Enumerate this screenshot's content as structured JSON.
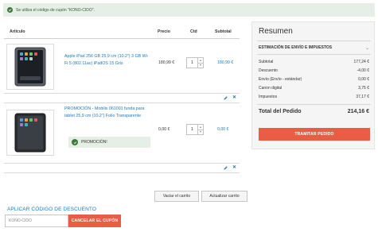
{
  "notice": {
    "text": "Se utiliza el código de cupón \"KONO-CIDO\"."
  },
  "table": {
    "headers": {
      "item": "Artículo",
      "price": "Precio",
      "qty": "Ctd",
      "subtotal": "Subtotal"
    }
  },
  "items": [
    {
      "name": "Apple iPad 256 GB 25,9 cm (10.2\") 3 GB Wi-Fi 5 (802.11ac) iPadOS 15 Gris",
      "price": "180,99 €",
      "qty": "1",
      "subtotal": "180,99 €",
      "image_icon": "tablet-icon",
      "promo": null
    },
    {
      "name": "PROMOCIÓN - Mobilis 061001 funda para tablet 25,9 cm (10.2\") Folio Transparente",
      "price": "0,00 €",
      "qty": "1",
      "subtotal": "0,00 €",
      "image_icon": "tablet-case-icon",
      "promo": "PROMOCIÓN!"
    }
  ],
  "actions": {
    "clear_cart": "Vaciar el carrito",
    "update_cart": "Actualizar carrito"
  },
  "discount": {
    "title": "APLICAR CÓDIGO DE DESCUENTO",
    "code_value": "KONO-CIDO",
    "cancel_label": "CANCELAR EL CUPÓN"
  },
  "summary": {
    "title": "Resumen",
    "shipping_label": "ESTIMACIÓN DE ENVÍO E IMPUESTOS",
    "rows": [
      {
        "label": "Subtotal",
        "value": "177,24 €"
      },
      {
        "label": "Descuento",
        "value": "-4,00 €"
      },
      {
        "label": "Envío (Envío - estándar)",
        "value": "0,00 €"
      },
      {
        "label": "Canon digital",
        "value": "3,75 €"
      },
      {
        "label": "Impuestos",
        "value": "37,17 €"
      }
    ],
    "total_label": "Total del Pedido",
    "total_value": "214,16 €",
    "checkout_label": "TRAMITAR PEDIDO"
  },
  "colors": {
    "accent": "#e85d43",
    "link": "#1979c3",
    "success_bg": "#e5efe5",
    "success_icon": "#3b7a3b"
  }
}
